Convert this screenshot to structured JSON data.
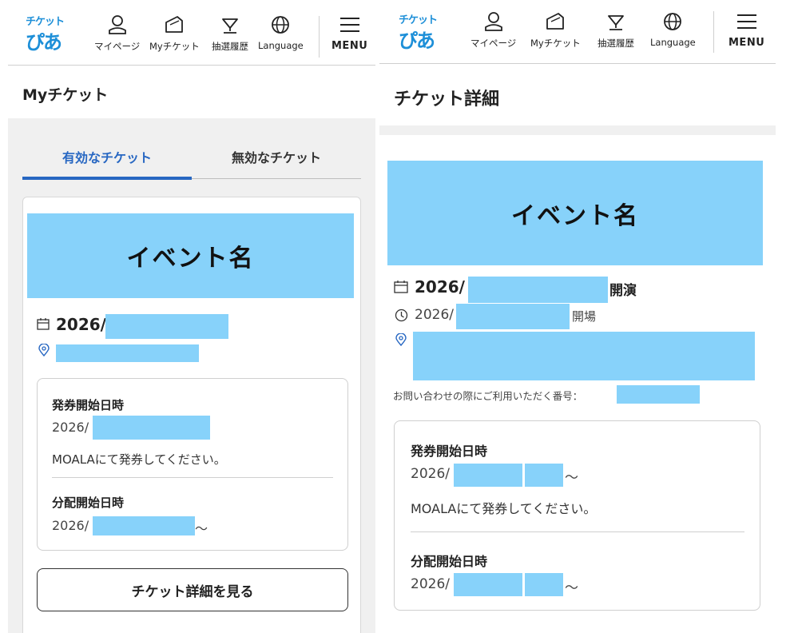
{
  "header": {
    "logo_top": "チケット",
    "logo_bottom": "ぴあ",
    "nav": {
      "mypage": "マイページ",
      "myticket": "Myチケット",
      "lottery": "抽選履歴",
      "language": "Language",
      "menu": "MENU"
    }
  },
  "left": {
    "page_title": "Myチケット",
    "tabs": {
      "active": "有効なチケット",
      "inactive": "無効なチケット"
    },
    "event_name": "イベント名",
    "date_prefix": "2026/",
    "issue_label": "発券開始日時",
    "issue_date_prefix": "2026/",
    "issue_note": "MOALAにて発券してください。",
    "dist_label": "分配開始日時",
    "dist_date_prefix": "2026/",
    "dist_suffix": "〜",
    "detail_button": "チケット詳細を見る"
  },
  "right": {
    "page_title": "チケット詳細",
    "event_name": "イベント名",
    "show_date_prefix": "2026/",
    "show_suffix": "開演",
    "open_date_prefix": "2026/",
    "open_suffix": "開場",
    "inquiry_label": "お問い合わせの際にご利用いただく番号：",
    "issue_label": "発券開始日時",
    "issue_date_prefix": "2026/",
    "issue_suffix": "〜",
    "issue_note": "MOALAにて発券してください。",
    "dist_label": "分配開始日時",
    "dist_date_prefix": "2026/",
    "dist_suffix": "〜"
  },
  "colors": {
    "accent": "#2767c2",
    "redaction": "#87d2fa",
    "logo": "#1d8fd8"
  }
}
